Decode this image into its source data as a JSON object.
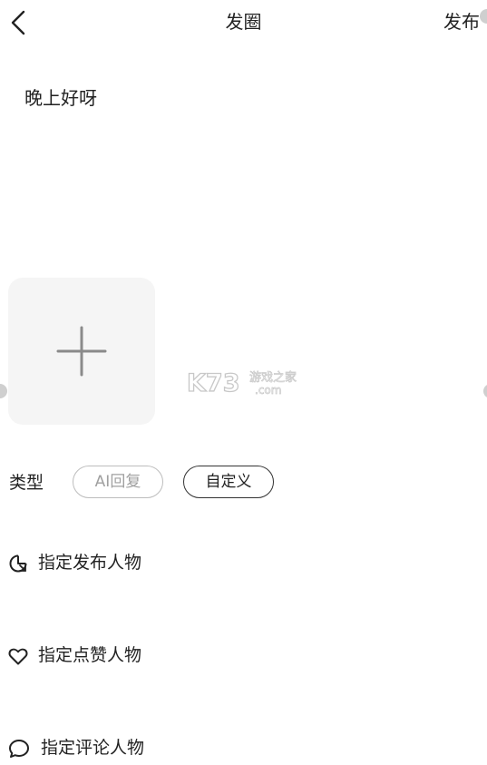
{
  "header": {
    "title": "发圈",
    "publish_label": "发布"
  },
  "post": {
    "text": "晚上好呀"
  },
  "media": {
    "add_icon": "plus-icon"
  },
  "watermark": {
    "logo_text": "K73",
    "site_cn": "游戏之家",
    "site_domain": ".com"
  },
  "type_section": {
    "label": "类型",
    "options": [
      {
        "label": "AI回复",
        "selected": false
      },
      {
        "label": "自定义",
        "selected": true
      }
    ]
  },
  "settings": [
    {
      "icon": "publisher-icon",
      "label": "指定发布人物"
    },
    {
      "icon": "heart-icon",
      "label": "指定点赞人物"
    },
    {
      "icon": "comment-icon",
      "label": "指定评论人物"
    }
  ],
  "colors": {
    "text": "#222222",
    "muted": "#a0a0a0",
    "tile_bg": "#f5f5f5"
  }
}
